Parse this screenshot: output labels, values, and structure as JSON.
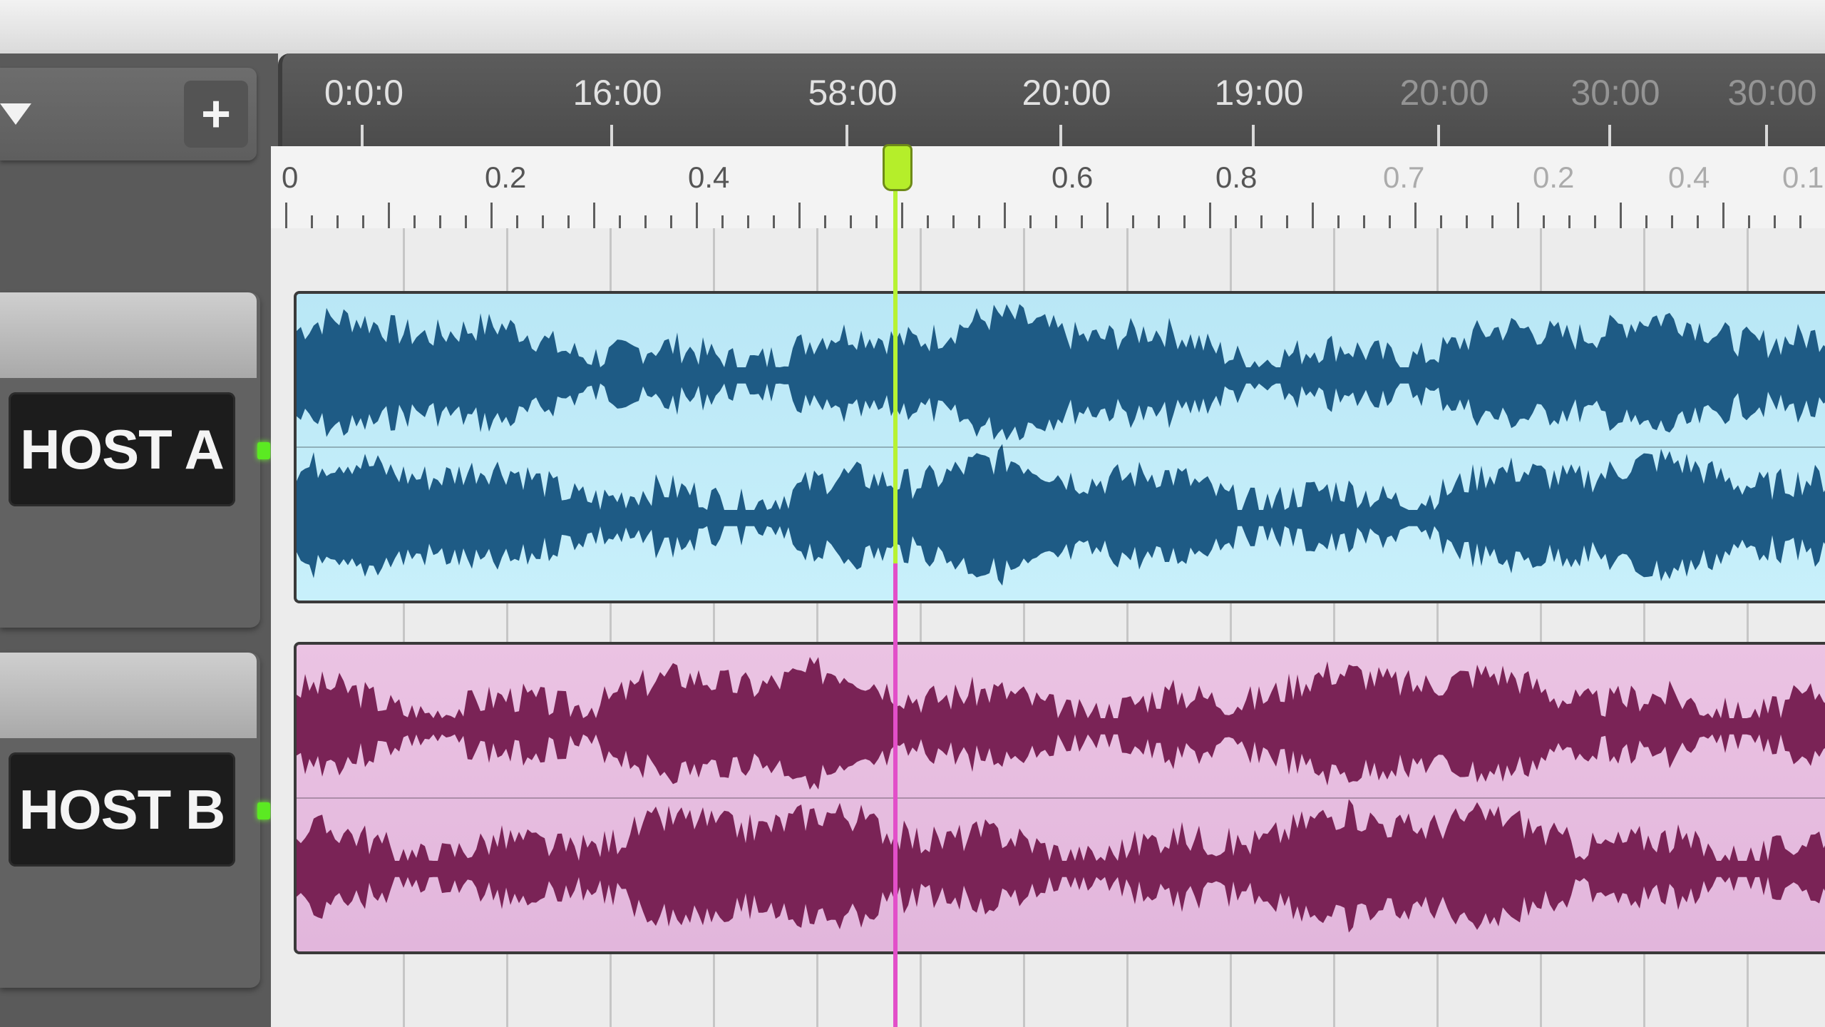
{
  "toolbar": {
    "add_label": "+"
  },
  "tracks": [
    {
      "name": "HOST A",
      "color": "#1e5b85",
      "clip_color": "#bde8f6"
    },
    {
      "name": "HOST B",
      "color": "#7a2356",
      "clip_color": "#e9c0e2"
    }
  ],
  "time_ruler": {
    "labels": [
      "0:0:0",
      "16:00",
      "58:00",
      "20:00",
      "19:00",
      "20:00",
      "30:00",
      "30:00"
    ]
  },
  "beat_ruler": {
    "labels": [
      "0",
      "0.2",
      "0.4",
      "0.6",
      "0.8",
      "0.7",
      "0.2",
      "0.4",
      "0.1"
    ]
  },
  "accent": {
    "playhead": "#b7f233",
    "track_b_playhead": "#e24fc9",
    "led": "#5bea22"
  }
}
